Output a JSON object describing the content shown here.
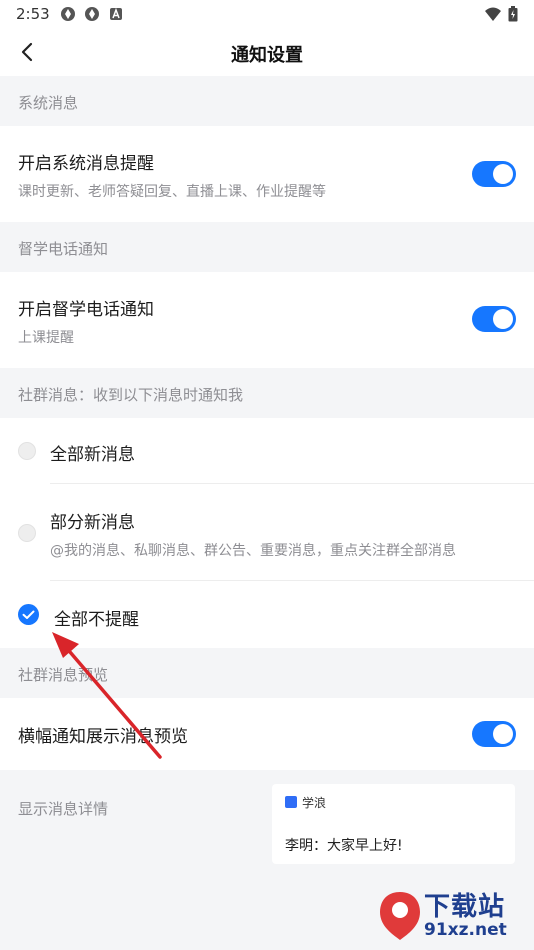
{
  "status_bar": {
    "time": "2:53"
  },
  "header": {
    "title": "通知设置"
  },
  "system": {
    "section_label": "系统消息",
    "title": "开启系统消息提醒",
    "subtitle": "课时更新、老师答疑回复、直播上课、作业提醒等",
    "enabled": true
  },
  "phone": {
    "section_label": "督学电话通知",
    "title": "开启督学电话通知",
    "subtitle": "上课提醒",
    "enabled": true
  },
  "community": {
    "section_label": "社群消息：收到以下消息时通知我",
    "options": [
      {
        "label": "全部新消息",
        "sub": "",
        "selected": false
      },
      {
        "label": "部分新消息",
        "sub": "@我的消息、私聊消息、群公告、重要消息，重点关注群全部消息",
        "selected": false
      },
      {
        "label": "全部不提醒",
        "sub": "",
        "selected": true
      }
    ]
  },
  "preview": {
    "section_label": "社群消息预览",
    "banner_title": "横幅通知展示消息预览",
    "banner_enabled": true,
    "detail_label": "显示消息详情",
    "card": {
      "app_name": "学浪",
      "message": "李明：大家早上好!"
    }
  },
  "watermark": {
    "text": "下载站",
    "url": "91xz.net"
  },
  "colors": {
    "accent": "#1677ff",
    "annotation_arrow": "#d9252a"
  }
}
